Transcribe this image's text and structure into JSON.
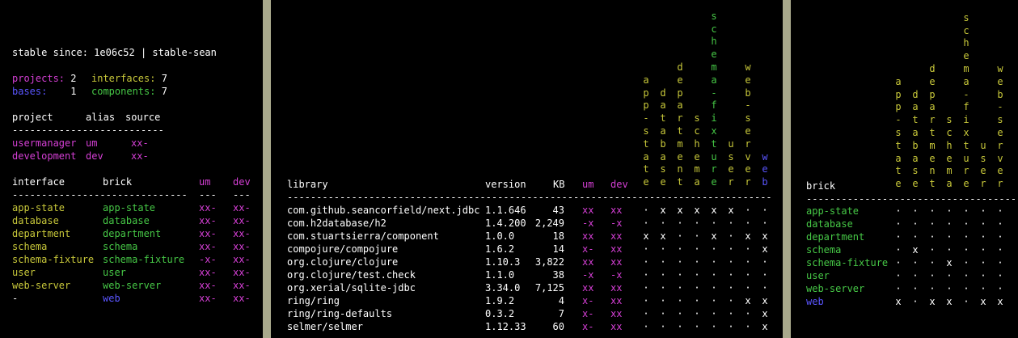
{
  "header": {
    "stable_label": "stable since:",
    "stable_value": "1e06c52 | stable-sean"
  },
  "counts": {
    "projects_label": "projects:",
    "projects_value": "2",
    "interfaces_label": "interfaces:",
    "interfaces_value": "7",
    "bases_label": "bases:",
    "bases_value": "1",
    "components_label": "components:",
    "components_value": "7"
  },
  "projects_table": {
    "headers": [
      "project",
      "alias",
      "source"
    ],
    "separator": "--------------------------",
    "rows": [
      {
        "project": "usermanager",
        "alias": "um",
        "source": "xx-"
      },
      {
        "project": "development",
        "alias": "dev",
        "source": "xx-"
      }
    ]
  },
  "interfaces_table": {
    "headers": [
      "interface",
      "brick",
      "um",
      "dev"
    ],
    "separator": "------------------------------",
    "sep_um": "---",
    "sep_dev": "---",
    "rows": [
      {
        "interface": "app-state",
        "brick": "app-state",
        "um": "xx-",
        "dev": "xx-",
        "iface_color": "#c8c83a",
        "brick_color": "#46c846"
      },
      {
        "interface": "database",
        "brick": "database",
        "um": "xx-",
        "dev": "xx-",
        "iface_color": "#c8c83a",
        "brick_color": "#46c846"
      },
      {
        "interface": "department",
        "brick": "department",
        "um": "xx-",
        "dev": "xx-",
        "iface_color": "#c8c83a",
        "brick_color": "#46c846"
      },
      {
        "interface": "schema",
        "brick": "schema",
        "um": "xx-",
        "dev": "xx-",
        "iface_color": "#c8c83a",
        "brick_color": "#46c846"
      },
      {
        "interface": "schema-fixture",
        "brick": "schema-fixture",
        "um": "-x-",
        "dev": "xx-",
        "iface_color": "#c8c83a",
        "brick_color": "#46c846"
      },
      {
        "interface": "user",
        "brick": "user",
        "um": "xx-",
        "dev": "xx-",
        "iface_color": "#c8c83a",
        "brick_color": "#46c846"
      },
      {
        "interface": "web-server",
        "brick": "web-server",
        "um": "xx-",
        "dev": "xx-",
        "iface_color": "#c8c83a",
        "brick_color": "#46c846"
      },
      {
        "interface": "-",
        "brick": "web",
        "um": "xx-",
        "dev": "xx-",
        "iface_color": "#ffffff",
        "brick_color": "#5a55ff"
      }
    ]
  },
  "libraries_table": {
    "headers": [
      "library",
      "version",
      "KB",
      "um",
      "dev"
    ],
    "separator": "------------------------------------------------------------------------------------------",
    "columns": [
      {
        "name": "app-state",
        "color": "#c8c83a"
      },
      {
        "name": "database",
        "color": "#c8c83a"
      },
      {
        "name": "department",
        "color": "#c8c83a"
      },
      {
        "name": "schema",
        "color": "#c8c83a"
      },
      {
        "name": "schema-fixture",
        "color": "#46c846"
      },
      {
        "name": "user",
        "color": "#c8c83a"
      },
      {
        "name": "web-server",
        "color": "#c8c83a"
      },
      {
        "name": "web",
        "color": "#5a55ff"
      }
    ],
    "rows": [
      {
        "library": "com.github.seancorfield/next.jdbc",
        "version": "1.1.646",
        "kb": "43",
        "um": "xx",
        "dev": "xx",
        "marks": "·xxxxx··"
      },
      {
        "library": "com.h2database/h2",
        "version": "1.4.200",
        "kb": "2,249",
        "um": "-x",
        "dev": "-x",
        "marks": "········"
      },
      {
        "library": "com.stuartsierra/component",
        "version": "1.0.0",
        "kb": "18",
        "um": "xx",
        "dev": "xx",
        "marks": "xx··x·xx"
      },
      {
        "library": "compojure/compojure",
        "version": "1.6.2",
        "kb": "14",
        "um": "x-",
        "dev": "xx",
        "marks": "·······x"
      },
      {
        "library": "org.clojure/clojure",
        "version": "1.10.3",
        "kb": "3,822",
        "um": "xx",
        "dev": "xx",
        "marks": "········"
      },
      {
        "library": "org.clojure/test.check",
        "version": "1.1.0",
        "kb": "38",
        "um": "-x",
        "dev": "-x",
        "marks": "········"
      },
      {
        "library": "org.xerial/sqlite-jdbc",
        "version": "3.34.0",
        "kb": "7,125",
        "um": "xx",
        "dev": "xx",
        "marks": "········"
      },
      {
        "library": "ring/ring",
        "version": "1.9.2",
        "kb": "4",
        "um": "x-",
        "dev": "xx",
        "marks": "······xx"
      },
      {
        "library": "ring/ring-defaults",
        "version": "0.3.2",
        "kb": "7",
        "um": "x-",
        "dev": "xx",
        "marks": "·······x"
      },
      {
        "library": "selmer/selmer",
        "version": "1.12.33",
        "kb": "60",
        "um": "x-",
        "dev": "xx",
        "marks": "·······x"
      }
    ]
  },
  "deps_table": {
    "header": "brick",
    "separator": "---------------------------------------",
    "columns": [
      {
        "name": "app-state",
        "color": "#c8c83a"
      },
      {
        "name": "database",
        "color": "#c8c83a"
      },
      {
        "name": "department",
        "color": "#c8c83a"
      },
      {
        "name": "schema",
        "color": "#c8c83a"
      },
      {
        "name": "schema-fixture",
        "color": "#c8c83a"
      },
      {
        "name": "user",
        "color": "#c8c83a"
      },
      {
        "name": "web-server",
        "color": "#c8c83a"
      }
    ],
    "rows": [
      {
        "brick": "app-state",
        "color": "#46c846",
        "marks": "·······"
      },
      {
        "brick": "database",
        "color": "#46c846",
        "marks": "·······"
      },
      {
        "brick": "department",
        "color": "#46c846",
        "marks": "·······"
      },
      {
        "brick": "schema",
        "color": "#46c846",
        "marks": "·x·····"
      },
      {
        "brick": "schema-fixture",
        "color": "#46c846",
        "marks": "···x···"
      },
      {
        "brick": "user",
        "color": "#46c846",
        "marks": "·······"
      },
      {
        "brick": "web-server",
        "color": "#46c846",
        "marks": "·······"
      },
      {
        "brick": "web",
        "color": "#5a55ff",
        "marks": "x·xx·xx"
      }
    ]
  }
}
